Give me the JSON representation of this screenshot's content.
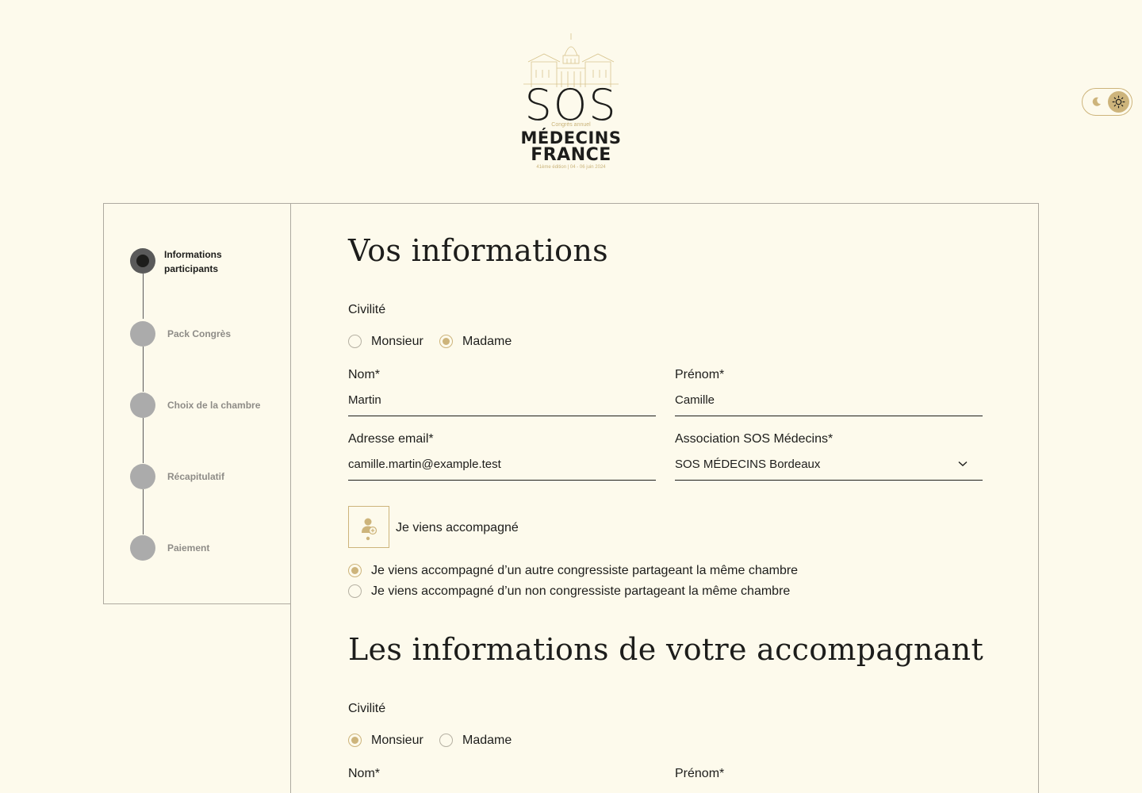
{
  "logo": {
    "sos": "SOS",
    "sub": "Congrès annuel",
    "medecins": "MÉDECINS",
    "france": "FRANCE",
    "edition": "41ème édition | 04 - 06 juin 2024"
  },
  "theme_toggle": {
    "moon_icon": "moon-icon",
    "sun_icon": "sun-icon",
    "active": "light"
  },
  "stepper": {
    "steps": [
      {
        "label_line1": "Informations",
        "label_line2": "participants",
        "active": true
      },
      {
        "label": "Pack Congrès",
        "active": false
      },
      {
        "label": "Choix de la chambre",
        "active": false
      },
      {
        "label": "Récapitulatif",
        "active": false
      },
      {
        "label": "Paiement",
        "active": false
      }
    ]
  },
  "participant": {
    "title": "Vos informations",
    "civilite_label": "Civilité",
    "civilite_options": [
      "Monsieur",
      "Madame"
    ],
    "civilite_selected": "Madame",
    "nom_label": "Nom*",
    "nom_value": "Martin",
    "prenom_label": "Prénom*",
    "prenom_value": "Camille",
    "email_label": "Adresse email*",
    "email_value": "camille.martin@example.test",
    "association_label": "Association SOS Médecins*",
    "association_value": "SOS MÉDECINS Bordeaux",
    "companion_label": "Je viens accompagné",
    "companion_options": [
      "Je viens accompagné d’un autre congressiste partageant la même chambre",
      "Je viens accompagné d’un non congressiste partageant la même chambre"
    ],
    "companion_selected": 0
  },
  "accompagnant": {
    "title": "Les informations de votre accompagnant",
    "civilite_label": "Civilité",
    "civilite_options": [
      "Monsieur",
      "Madame"
    ],
    "civilite_selected": "Monsieur",
    "nom_label": "Nom*",
    "prenom_label": "Prénom*"
  },
  "colors": {
    "background": "#fdfaec",
    "gold": "#cdb47b",
    "text": "#1d1d1b",
    "step_inactive": "#ababab"
  }
}
